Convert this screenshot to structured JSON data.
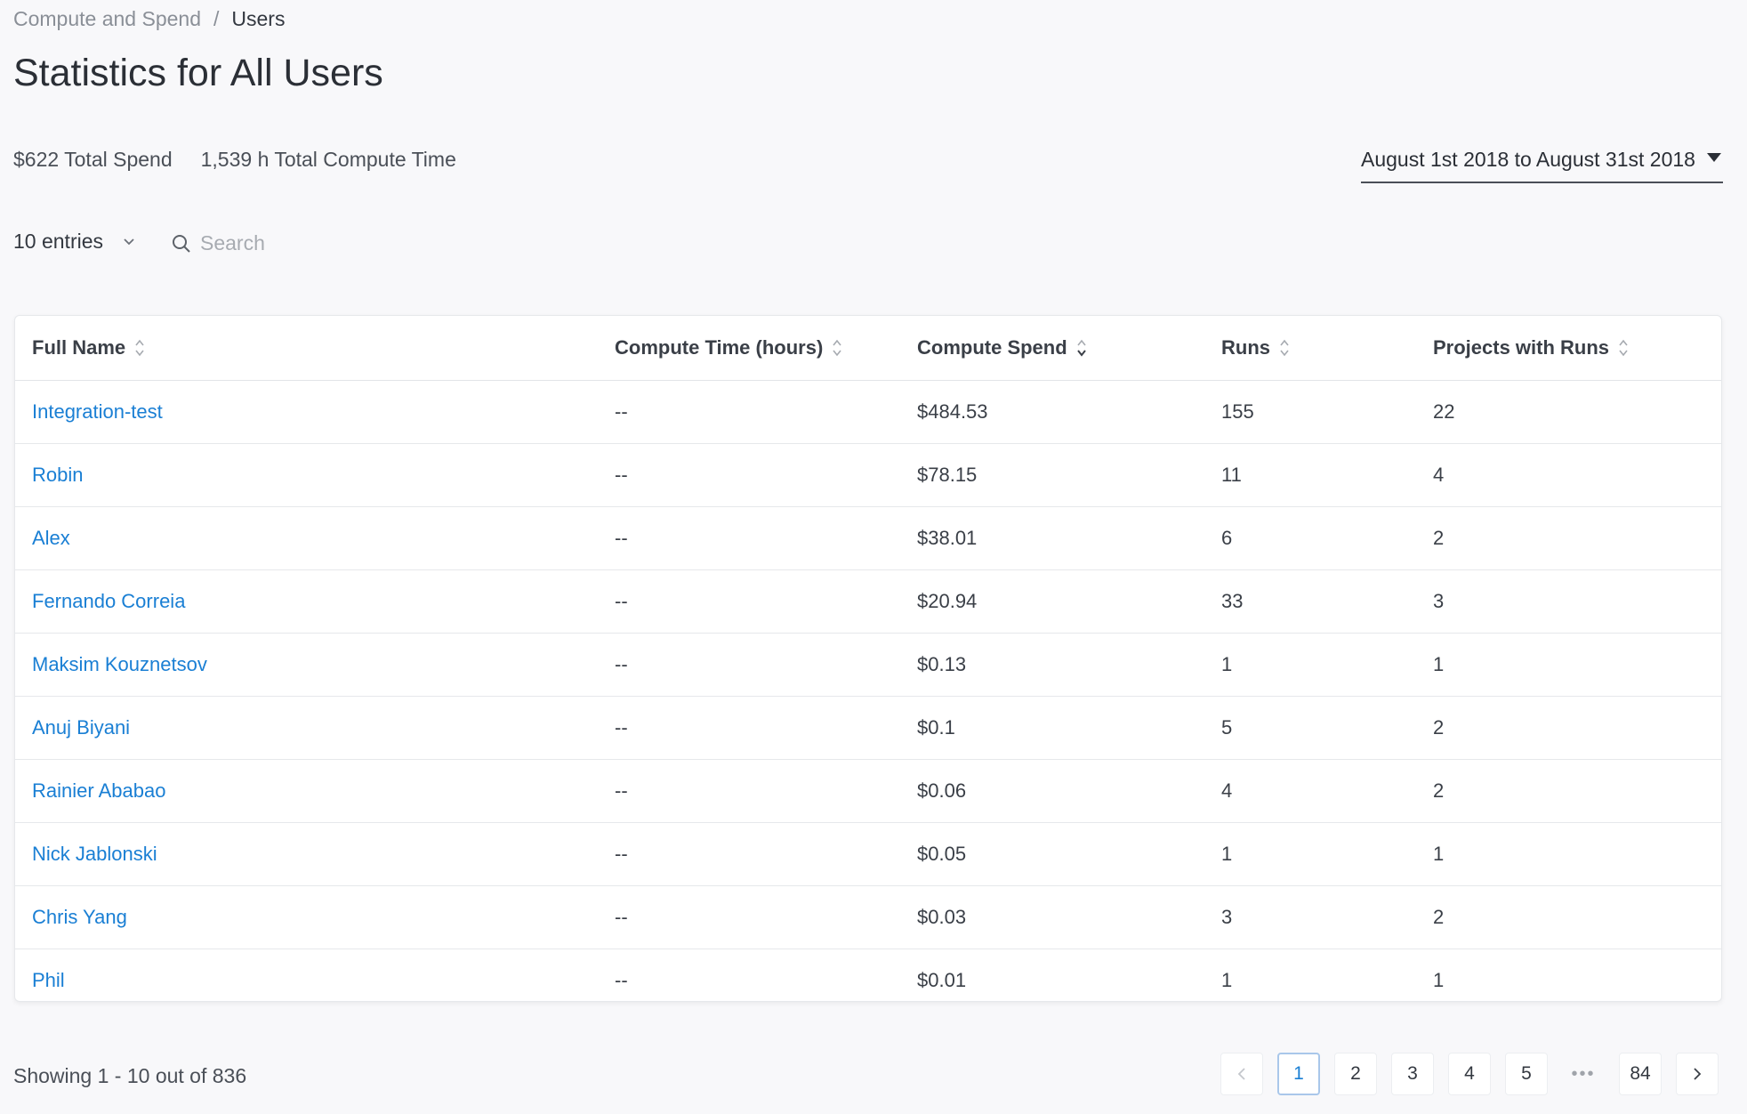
{
  "breadcrumb": {
    "parent": "Compute and Spend",
    "separator": "/",
    "current": "Users"
  },
  "page_title": "Statistics for All Users",
  "summary": {
    "total_spend": "$622 Total Spend",
    "total_compute": "1,539 h Total Compute Time"
  },
  "date_range": {
    "label": "August 1st 2018 to August 31st 2018"
  },
  "entries": {
    "selected": "10 entries"
  },
  "search": {
    "placeholder": "Search"
  },
  "table": {
    "headers": [
      "Full Name",
      "Compute Time (hours)",
      "Compute Spend",
      "Runs",
      "Projects with Runs"
    ],
    "rows": [
      [
        "Integration-test",
        "--",
        "$484.53",
        "155",
        "22"
      ],
      [
        "Robin",
        "--",
        "$78.15",
        "11",
        "4"
      ],
      [
        "Alex",
        "--",
        "$38.01",
        "6",
        "2"
      ],
      [
        "Fernando Correia",
        "--",
        "$20.94",
        "33",
        "3"
      ],
      [
        "Maksim Kouznetsov",
        "--",
        "$0.13",
        "1",
        "1"
      ],
      [
        "Anuj Biyani",
        "--",
        "$0.1",
        "5",
        "2"
      ],
      [
        "Rainier Ababao",
        "--",
        "$0.06",
        "4",
        "2"
      ],
      [
        "Nick Jablonski",
        "--",
        "$0.05",
        "1",
        "1"
      ],
      [
        "Chris Yang",
        "--",
        "$0.03",
        "3",
        "2"
      ],
      [
        "Phil",
        "--",
        "$0.01",
        "1",
        "1"
      ]
    ]
  },
  "footer": {
    "showing": "Showing 1 - 10 out of 836"
  },
  "pagination": {
    "pages": [
      "1",
      "2",
      "3",
      "4",
      "5"
    ],
    "ellipsis": "•••",
    "last": "84",
    "current": "1"
  },
  "colors": {
    "link": "#1a7fd4",
    "background": "#f8f8fa",
    "active_page_border": "#a9c7ea"
  }
}
